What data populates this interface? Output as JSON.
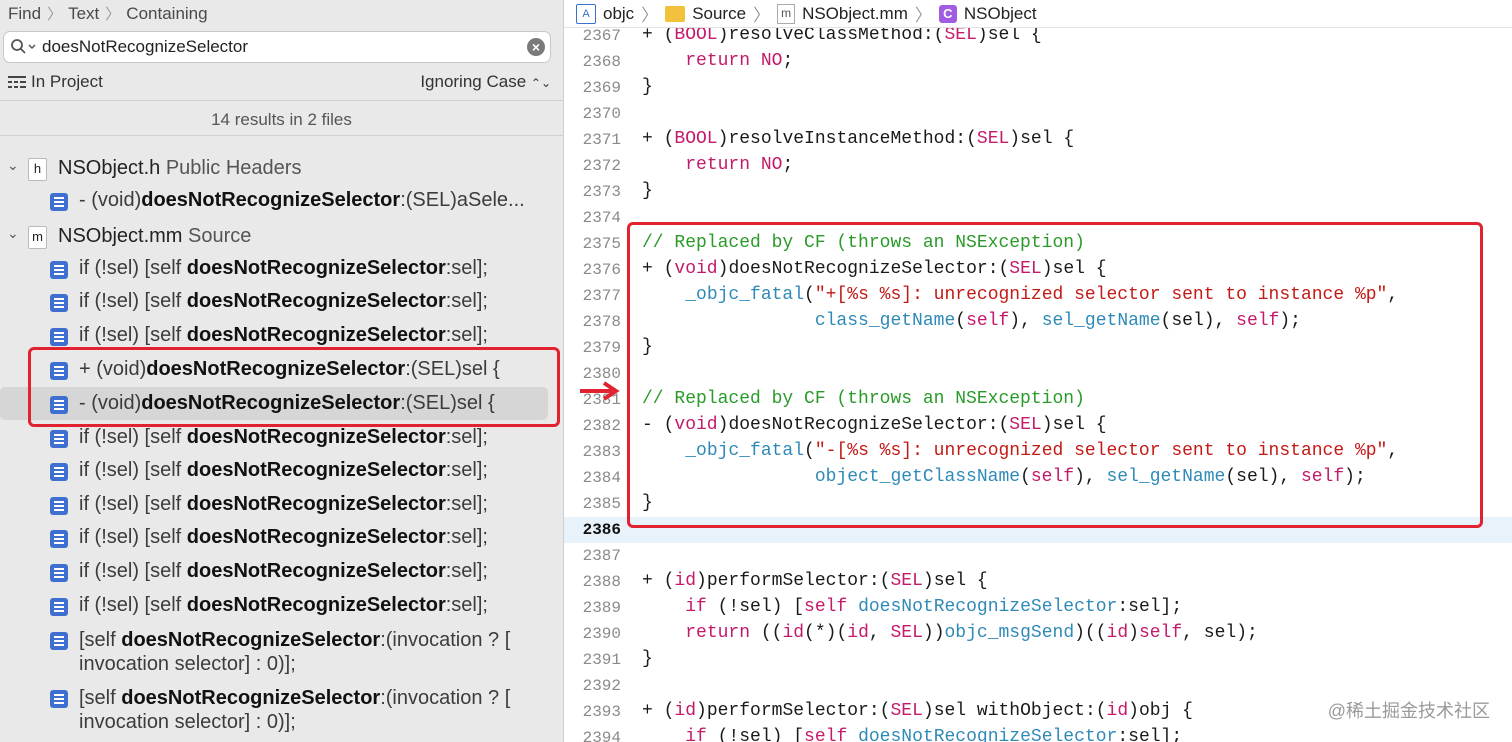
{
  "find": {
    "crumbs": [
      "Find",
      "Text",
      "Containing"
    ],
    "query": "doesNotRecognizeSelector",
    "scope": "In Project",
    "case_mode": "Ignoring Case",
    "summary": "14 results in 2 files"
  },
  "files": [
    {
      "icon": "h",
      "name": "NSObject.h",
      "group": "Public Headers"
    },
    {
      "icon": "m",
      "name": "NSObject.mm",
      "group": "Source"
    }
  ],
  "results": [
    {
      "pre": "- (void)",
      "match": "doesNotRecognizeSelector",
      "post": ":(SEL)aSele..."
    },
    {
      "pre": "if (!sel) [self ",
      "match": "doesNotRecognizeSelector",
      "post": ":sel];"
    },
    {
      "pre": "if (!sel) [self ",
      "match": "doesNotRecognizeSelector",
      "post": ":sel];"
    },
    {
      "pre": "if (!sel) [self ",
      "match": "doesNotRecognizeSelector",
      "post": ":sel];"
    },
    {
      "pre": "+ (void)",
      "match": "doesNotRecognizeSelector",
      "post": ":(SEL)sel {"
    },
    {
      "pre": "- (void)",
      "match": "doesNotRecognizeSelector",
      "post": ":(SEL)sel {"
    },
    {
      "pre": "if (!sel) [self ",
      "match": "doesNotRecognizeSelector",
      "post": ":sel];"
    },
    {
      "pre": "if (!sel) [self ",
      "match": "doesNotRecognizeSelector",
      "post": ":sel];"
    },
    {
      "pre": "if (!sel) [self ",
      "match": "doesNotRecognizeSelector",
      "post": ":sel];"
    },
    {
      "pre": "if (!sel) [self ",
      "match": "doesNotRecognizeSelector",
      "post": ":sel];"
    },
    {
      "pre": "if (!sel) [self ",
      "match": "doesNotRecognizeSelector",
      "post": ":sel];"
    },
    {
      "pre": "if (!sel) [self ",
      "match": "doesNotRecognizeSelector",
      "post": ":sel];"
    },
    {
      "pre": "[self ",
      "match": "doesNotRecognizeSelector",
      "post": ":(invocation ? [ invocation selector] : 0)];"
    },
    {
      "pre": "[self ",
      "match": "doesNotRecognizeSelector",
      "post": ":(invocation ? [ invocation selector] : 0)];"
    }
  ],
  "jumpbar": [
    "objc",
    "Source",
    "NSObject.mm",
    "NSObject"
  ],
  "code": [
    {
      "n": "2367",
      "t": "+ (BOOL)resolveClassMethod:(SEL)sel {"
    },
    {
      "n": "2368",
      "t": "    return NO;"
    },
    {
      "n": "2369",
      "t": "}"
    },
    {
      "n": "2370",
      "t": ""
    },
    {
      "n": "2371",
      "t": "+ (BOOL)resolveInstanceMethod:(SEL)sel {"
    },
    {
      "n": "2372",
      "t": "    return NO;"
    },
    {
      "n": "2373",
      "t": "}"
    },
    {
      "n": "2374",
      "t": ""
    },
    {
      "n": "2375",
      "t": "// Replaced by CF (throws an NSException)"
    },
    {
      "n": "2376",
      "t": "+ (void)doesNotRecognizeSelector:(SEL)sel {"
    },
    {
      "n": "2377",
      "t": "    _objc_fatal(\"+[%s %s]: unrecognized selector sent to instance %p\","
    },
    {
      "n": "2378",
      "t": "                class_getName(self), sel_getName(sel), self);"
    },
    {
      "n": "2379",
      "t": "}"
    },
    {
      "n": "2380",
      "t": ""
    },
    {
      "n": "2381",
      "t": "// Replaced by CF (throws an NSException)"
    },
    {
      "n": "2382",
      "t": "- (void)doesNotRecognizeSelector:(SEL)sel {"
    },
    {
      "n": "2383",
      "t": "    _objc_fatal(\"-[%s %s]: unrecognized selector sent to instance %p\","
    },
    {
      "n": "2384",
      "t": "                object_getClassName(self), sel_getName(sel), self);"
    },
    {
      "n": "2385",
      "t": "}"
    },
    {
      "n": "2386",
      "t": ""
    },
    {
      "n": "2387",
      "t": ""
    },
    {
      "n": "2388",
      "t": "+ (id)performSelector:(SEL)sel {"
    },
    {
      "n": "2389",
      "t": "    if (!sel) [self doesNotRecognizeSelector:sel];"
    },
    {
      "n": "2390",
      "t": "    return ((id(*)(id, SEL))objc_msgSend)((id)self, sel);"
    },
    {
      "n": "2391",
      "t": "}"
    },
    {
      "n": "2392",
      "t": ""
    },
    {
      "n": "2393",
      "t": "+ (id)performSelector:(SEL)sel withObject:(id)obj {"
    },
    {
      "n": "2394",
      "t": "    if (!sel) [self doesNotRecognizeSelector:sel];"
    }
  ],
  "current_line": "2386",
  "watermark": "@稀土掘金技术社区",
  "colors": {
    "keyword": "#c41a6a",
    "comment": "#2a9b2a",
    "string": "#c41a16",
    "function": "#2f8ab8",
    "highlight": "#e0232f"
  }
}
